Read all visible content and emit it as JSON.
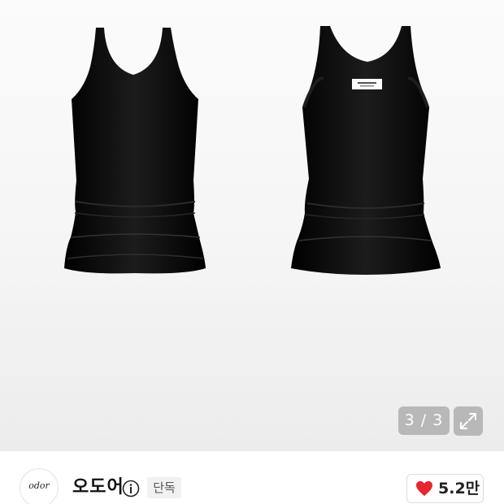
{
  "gallery": {
    "counter": "3 / 3",
    "expand_icon": "expand-arrows-icon",
    "garment_label_color": "#ffffff",
    "garment_color": "#0a0a0a"
  },
  "brand": {
    "logo_text": "odor",
    "name": "오도어",
    "info_icon": "info-icon",
    "badge": "단독"
  },
  "like": {
    "icon": "heart-icon",
    "count": "5.2만",
    "heart_color": "#e8262f"
  }
}
